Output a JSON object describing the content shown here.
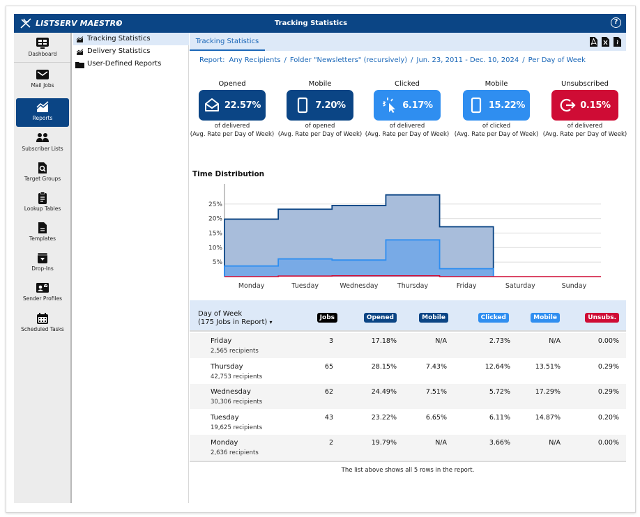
{
  "app": {
    "brand": "LISTSERV MAESTRO",
    "page_title": "Tracking Statistics",
    "help_label": "?"
  },
  "nav": {
    "items": [
      {
        "label": "Dashboard",
        "icon": "dashboard-icon",
        "active": false
      },
      {
        "label": "Mail Jobs",
        "icon": "envelope-icon",
        "active": false
      },
      {
        "label": "Reports",
        "icon": "chart-icon",
        "active": true
      },
      {
        "label": "Subscriber Lists",
        "icon": "users-icon",
        "active": false
      },
      {
        "label": "Target Groups",
        "icon": "search-document-icon",
        "active": false
      },
      {
        "label": "Lookup Tables",
        "icon": "clipboard-icon",
        "active": false
      },
      {
        "label": "Templates",
        "icon": "file-icon",
        "active": false
      },
      {
        "label": "Drop-Ins",
        "icon": "drop-in-icon",
        "active": false
      },
      {
        "label": "Sender Profiles",
        "icon": "id-card-icon",
        "active": false
      },
      {
        "label": "Scheduled Tasks",
        "icon": "calendar-icon",
        "active": false
      }
    ]
  },
  "tree": {
    "items": [
      {
        "label": "Tracking Statistics",
        "icon": "chart-icon",
        "active": true
      },
      {
        "label": "Delivery Statistics",
        "icon": "chart-icon",
        "active": false
      },
      {
        "label": "User-Defined Reports",
        "icon": "folder-icon",
        "active": false
      }
    ]
  },
  "main": {
    "tab_label": "Tracking Statistics",
    "export_icons": [
      "pdf-export-icon",
      "excel-export-icon",
      "file-export-icon"
    ],
    "breadcrumb": [
      "Report:",
      "Any Recipients",
      "Folder \"Newsletters\" (recursively)",
      "Jun. 23, 2011 - Dec. 10, 2024",
      "Per Day of Week"
    ],
    "breadcrumb_sep": "/"
  },
  "stats": [
    {
      "title": "Opened",
      "value": "22.57%",
      "sub1": "of delivered",
      "sub2": "(Avg. Rate per Day of Week)",
      "color": "#0b4585",
      "icon": "envelope-open-icon"
    },
    {
      "title": "Mobile",
      "value": "7.20%",
      "sub1": "of opened",
      "sub2": "(Avg. Rate per Day of Week)",
      "color": "#0b4585",
      "icon": "mobile-icon"
    },
    {
      "title": "Clicked",
      "value": "6.17%",
      "sub1": "of delivered",
      "sub2": "(Avg. Rate per Day of Week)",
      "color": "#2f8ef0",
      "icon": "click-icon"
    },
    {
      "title": "Mobile",
      "value": "15.22%",
      "sub1": "of clicked",
      "sub2": "(Avg. Rate per Day of Week)",
      "color": "#2f8ef0",
      "icon": "mobile-icon"
    },
    {
      "title": "Unsubscribed",
      "value": "0.15%",
      "sub1": "of delivered",
      "sub2": "(Avg. Rate per Day of Week)",
      "color": "#cf0c35",
      "icon": "sign-out-icon"
    }
  ],
  "chart_data": {
    "type": "area",
    "title": "Time Distribution",
    "categories": [
      "Monday",
      "Tuesday",
      "Wednesday",
      "Thursday",
      "Friday",
      "Saturday",
      "Sunday"
    ],
    "series": [
      {
        "name": "Opened",
        "values": [
          19.79,
          23.22,
          24.49,
          28.15,
          17.18,
          null,
          null
        ],
        "color": "#0b4585"
      },
      {
        "name": "Clicked",
        "values": [
          3.66,
          6.11,
          5.72,
          12.64,
          2.73,
          null,
          null
        ],
        "color": "#2f8ef0"
      },
      {
        "name": "Unsubscribed",
        "values": [
          0.0,
          0.2,
          0.29,
          0.29,
          0.0,
          0.0,
          0.0
        ],
        "color": "#cf0c35"
      }
    ],
    "yticks": [
      "5%",
      "10%",
      "15%",
      "20%",
      "25%"
    ],
    "ylim": [
      0,
      30
    ],
    "grid": true,
    "xlabel": "",
    "ylabel": ""
  },
  "table": {
    "header_day": "Day of Week",
    "header_count": "(175 Jobs in Report)",
    "sort_icon": "▾",
    "columns": [
      {
        "label": "Jobs",
        "color": "#000000"
      },
      {
        "label": "Opened",
        "color": "#0b4585"
      },
      {
        "label": "Mobile",
        "color": "#0b4585"
      },
      {
        "label": "Clicked",
        "color": "#2f8ef0"
      },
      {
        "label": "Mobile",
        "color": "#2f8ef0"
      },
      {
        "label": "Unsubs.",
        "color": "#cf0c35"
      }
    ],
    "rows": [
      {
        "day": "Friday",
        "recipients": "2,565 recipients",
        "values": [
          "3",
          "17.18%",
          "N/A",
          "2.73%",
          "N/A",
          "0.00%"
        ]
      },
      {
        "day": "Thursday",
        "recipients": "42,753 recipients",
        "values": [
          "65",
          "28.15%",
          "7.43%",
          "12.64%",
          "13.51%",
          "0.29%"
        ]
      },
      {
        "day": "Wednesday",
        "recipients": "30,306 recipients",
        "values": [
          "62",
          "24.49%",
          "7.51%",
          "5.72%",
          "17.29%",
          "0.29%"
        ]
      },
      {
        "day": "Tuesday",
        "recipients": "19,625 recipients",
        "values": [
          "43",
          "23.22%",
          "6.65%",
          "6.11%",
          "14.87%",
          "0.20%"
        ]
      },
      {
        "day": "Monday",
        "recipients": "2,636 recipients",
        "values": [
          "2",
          "19.79%",
          "N/A",
          "3.66%",
          "N/A",
          "0.00%"
        ]
      }
    ],
    "footer": "The list above shows all 5 rows in the report."
  }
}
